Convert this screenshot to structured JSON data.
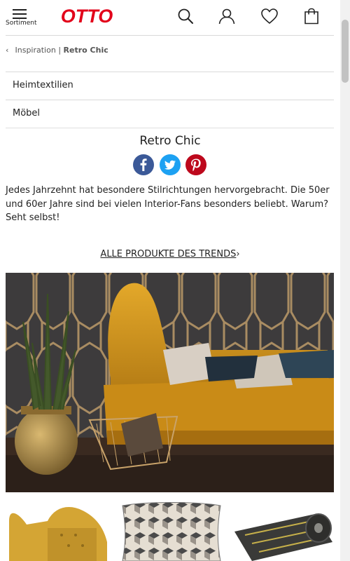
{
  "header": {
    "menu_label": "Sortiment",
    "logo_text": "OTTO",
    "brand_color": "#e2001a",
    "icons": [
      "search-icon",
      "user-icon",
      "heart-icon",
      "cart-icon"
    ]
  },
  "breadcrumb": {
    "parent": "Inspiration",
    "separator": "|",
    "current": "Retro Chic"
  },
  "categories": [
    {
      "label": "Heimtextilien"
    },
    {
      "label": "Möbel"
    }
  ],
  "page": {
    "title": "Retro Chic",
    "intro": "Jedes Jahrzehnt hat besondere Stilrichtungen hervorgebracht. Die 50er und 60er Jahre sind bei vielen Interior-Fans besonders beliebt. Warum? Seht selbst!",
    "cta_label": "ALLE PRODUKTE DES TRENDS",
    "cta_chevron": "›"
  },
  "share": {
    "facebook_color": "#3b5998",
    "twitter_color": "#1da1f2",
    "pinterest_color": "#bd081c"
  },
  "colors": {
    "mustard": "#d69a1b",
    "wall": "#3d3b3c",
    "gold": "#b59566"
  }
}
